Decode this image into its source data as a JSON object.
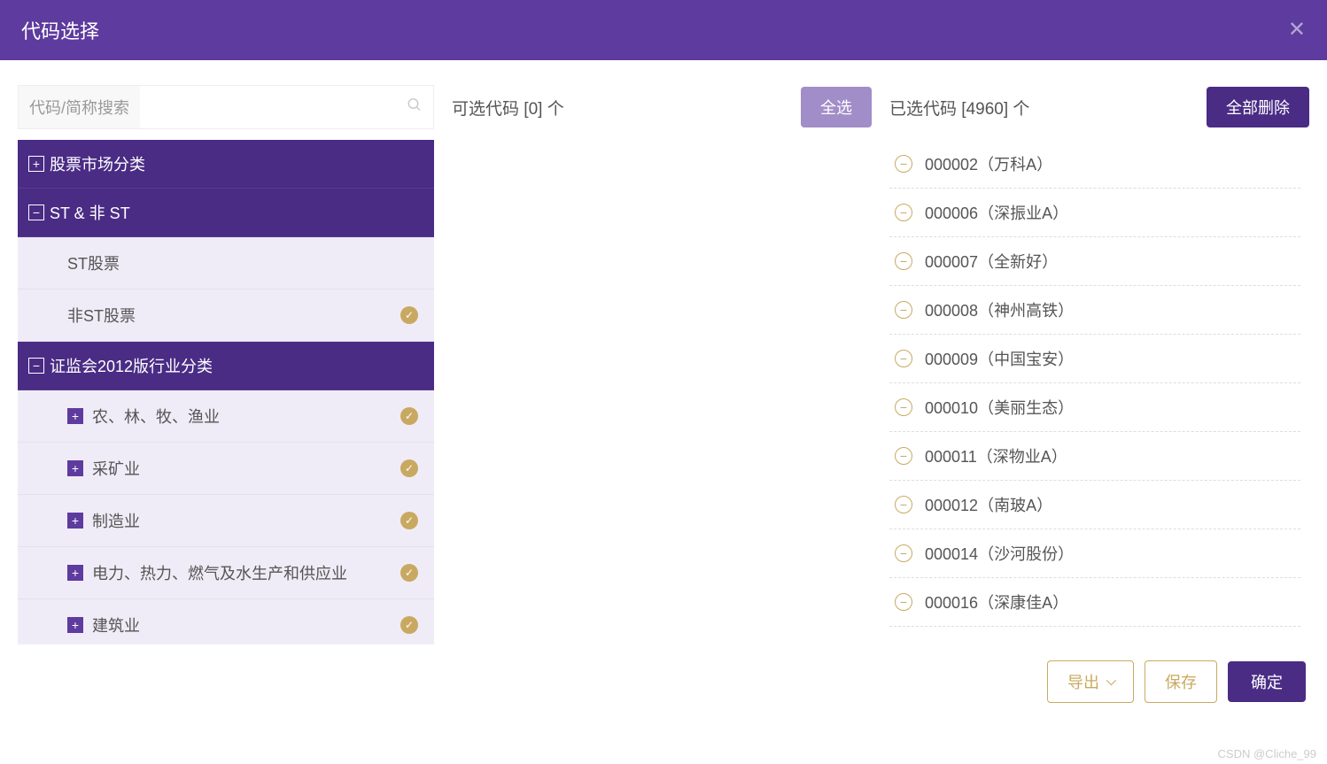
{
  "header": {
    "title": "代码选择"
  },
  "search": {
    "label": "代码/简称搜索",
    "value": ""
  },
  "tree": {
    "cat_stock_market": "股票市场分类",
    "cat_st": "ST & 非 ST",
    "st_items": [
      {
        "label": "ST股票",
        "checked": false
      },
      {
        "label": "非ST股票",
        "checked": true
      }
    ],
    "cat_csrc": "证监会2012版行业分类",
    "csrc_items": [
      {
        "label": "农、林、牧、渔业",
        "checked": true
      },
      {
        "label": "采矿业",
        "checked": true
      },
      {
        "label": "制造业",
        "checked": true
      },
      {
        "label": "电力、热力、燃气及水生产和供应业",
        "checked": true
      },
      {
        "label": "建筑业",
        "checked": true
      }
    ]
  },
  "available": {
    "title_prefix": "可选代码 [",
    "count": "0",
    "title_suffix": "] 个",
    "select_all": "全选"
  },
  "selected": {
    "title_prefix": "已选代码 [",
    "count": "4960",
    "title_suffix": "] 个",
    "delete_all": "全部删除",
    "items": [
      "000002（万科A）",
      "000006（深振业A）",
      "000007（全新好）",
      "000008（神州高铁）",
      "000009（中国宝安）",
      "000010（美丽生态）",
      "000011（深物业A）",
      "000012（南玻A）",
      "000014（沙河股份）",
      "000016（深康佳A）"
    ]
  },
  "footer": {
    "export": "导出",
    "save": "保存",
    "confirm": "确定"
  },
  "watermark": "CSDN @Cliche_99"
}
